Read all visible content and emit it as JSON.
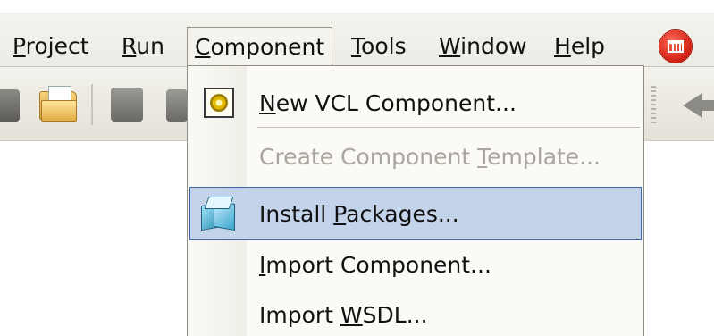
{
  "menubar": {
    "items": [
      {
        "id": "project",
        "mnemonic": "P",
        "rest": "roject"
      },
      {
        "id": "run",
        "mnemonic": "R",
        "rest": "un"
      },
      {
        "id": "component",
        "mnemonic": "C",
        "rest": "omponent"
      },
      {
        "id": "tools",
        "mnemonic": "T",
        "rest": "ools"
      },
      {
        "id": "window",
        "mnemonic": "W",
        "rest": "indow"
      },
      {
        "id": "help",
        "mnemonic": "H",
        "rest": "elp"
      }
    ]
  },
  "dropdown": {
    "items": [
      {
        "pre": "",
        "mnemonic": "N",
        "post": "ew VCL Component...",
        "icon": "vcl-component-icon",
        "enabled": true
      },
      {
        "pre": "Create Component ",
        "mnemonic": "T",
        "post": "emplate...",
        "icon": "",
        "enabled": false
      },
      {
        "pre": "Install ",
        "mnemonic": "P",
        "post": "ackages...",
        "icon": "packages-icon",
        "enabled": true,
        "highlighted": true
      },
      {
        "pre": "",
        "mnemonic": "I",
        "post": "mport Component...",
        "icon": "",
        "enabled": true
      },
      {
        "pre": "Import ",
        "mnemonic": "W",
        "post": "SDL...",
        "icon": "",
        "enabled": true
      }
    ]
  },
  "colors": {
    "highlight_bg": "#c3d3ea",
    "highlight_border": "#3d63a8",
    "disabled_text": "#a8a69d",
    "close_button": "#d01f12"
  }
}
